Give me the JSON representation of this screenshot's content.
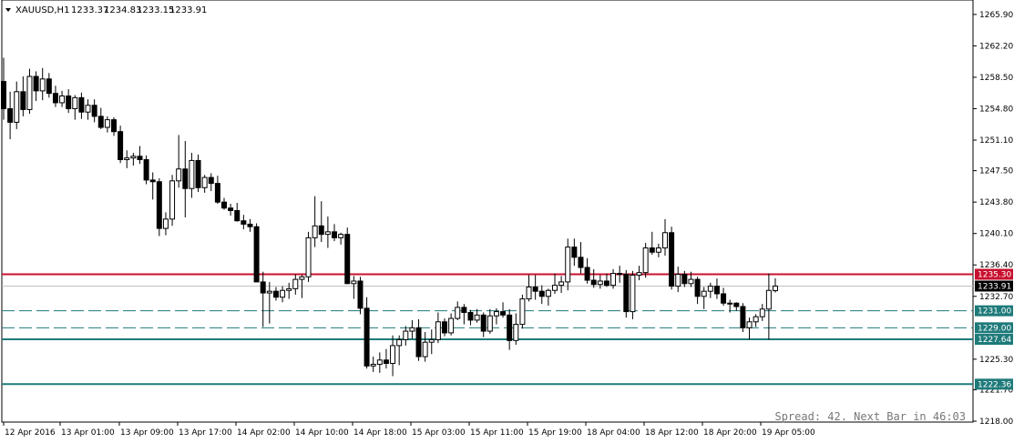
{
  "chart_data": {
    "type": "candlestick",
    "title": "XAUUSD,H1",
    "ohlc_header": [
      "1233.37",
      "1234.83",
      "1233.15",
      "1233.91"
    ],
    "ylim": [
      1218.0,
      1267.6
    ],
    "y_ticks": [
      "1265.90",
      "1262.20",
      "1258.50",
      "1254.80",
      "1251.10",
      "1247.50",
      "1243.80",
      "1240.10",
      "1236.40",
      "1232.70",
      "1225.30",
      "1221.70",
      "1218.00"
    ],
    "x_ticks": [
      "12 Apr 2016",
      "13 Apr 01:00",
      "13 Apr 09:00",
      "13 Apr 17:00",
      "14 Apr 02:00",
      "14 Apr 10:00",
      "14 Apr 18:00",
      "15 Apr 03:00",
      "15 Apr 11:00",
      "15 Apr 19:00",
      "18 Apr 04:00",
      "18 Apr 12:00",
      "18 Apr 20:00",
      "19 Apr 05:00"
    ],
    "levels": [
      {
        "label": "1235.30",
        "value": 1235.3,
        "style": "solid",
        "color": "#c8102e"
      },
      {
        "label": "1231.00",
        "value": 1231.0,
        "style": "dashed",
        "color": "#1f7a7a"
      },
      {
        "label": "1229.00",
        "value": 1229.0,
        "style": "dashed",
        "color": "#1f7a7a"
      },
      {
        "label": "1227.64",
        "value": 1227.64,
        "style": "solid",
        "color": "#1f7a7a"
      },
      {
        "label": "1222.36",
        "value": 1222.36,
        "style": "solid",
        "color": "#1f7a7a"
      }
    ],
    "current_price": {
      "label": "1233.91",
      "value": 1233.91
    },
    "spread_text": "Spread: 42. Next Bar in 46:03",
    "candles": [
      [
        1258.0,
        1260.8,
        1253.5,
        1254.8
      ],
      [
        1254.8,
        1256.8,
        1251.2,
        1253.2
      ],
      [
        1253.2,
        1258.0,
        1252.4,
        1256.8
      ],
      [
        1256.8,
        1258.6,
        1253.9,
        1254.7
      ],
      [
        1254.7,
        1259.5,
        1254.2,
        1258.6
      ],
      [
        1258.6,
        1259.2,
        1255.7,
        1256.9
      ],
      [
        1256.9,
        1259.6,
        1255.8,
        1258.3
      ],
      [
        1258.3,
        1259.0,
        1256.1,
        1256.6
      ],
      [
        1256.6,
        1257.5,
        1255.0,
        1255.5
      ],
      [
        1255.5,
        1256.9,
        1255.0,
        1256.3
      ],
      [
        1256.3,
        1257.1,
        1254.3,
        1254.8
      ],
      [
        1254.8,
        1256.4,
        1253.5,
        1256.1
      ],
      [
        1256.1,
        1256.7,
        1253.6,
        1254.4
      ],
      [
        1254.4,
        1255.9,
        1253.5,
        1255.2
      ],
      [
        1255.2,
        1255.9,
        1253.2,
        1253.9
      ],
      [
        1253.9,
        1254.9,
        1252.4,
        1252.6
      ],
      [
        1252.6,
        1253.9,
        1252.0,
        1253.5
      ],
      [
        1253.5,
        1253.8,
        1251.6,
        1252.1
      ],
      [
        1252.1,
        1252.8,
        1248.4,
        1248.8
      ],
      [
        1248.8,
        1249.9,
        1247.8,
        1249.0
      ],
      [
        1249.0,
        1249.6,
        1248.1,
        1249.2
      ],
      [
        1249.2,
        1250.4,
        1248.3,
        1248.8
      ],
      [
        1248.8,
        1249.3,
        1245.9,
        1246.4
      ],
      [
        1246.4,
        1247.3,
        1244.1,
        1246.2
      ],
      [
        1246.2,
        1246.6,
        1239.8,
        1240.7
      ],
      [
        1240.7,
        1242.6,
        1239.9,
        1241.8
      ],
      [
        1241.8,
        1247.0,
        1241.0,
        1246.3
      ],
      [
        1246.3,
        1251.7,
        1245.5,
        1247.7
      ],
      [
        1247.7,
        1251.0,
        1242.0,
        1245.4
      ],
      [
        1245.4,
        1249.6,
        1244.3,
        1248.7
      ],
      [
        1248.7,
        1249.4,
        1245.0,
        1245.5
      ],
      [
        1245.5,
        1247.0,
        1244.9,
        1246.7
      ],
      [
        1246.7,
        1247.2,
        1245.1,
        1246.0
      ],
      [
        1246.0,
        1246.9,
        1243.6,
        1243.8
      ],
      [
        1243.8,
        1244.3,
        1242.9,
        1243.1
      ],
      [
        1243.1,
        1243.6,
        1242.2,
        1242.8
      ],
      [
        1242.8,
        1243.7,
        1241.5,
        1241.6
      ],
      [
        1241.6,
        1242.3,
        1240.6,
        1241.2
      ],
      [
        1241.2,
        1241.8,
        1240.3,
        1240.9
      ],
      [
        1240.9,
        1241.3,
        1235.9,
        1234.4
      ],
      [
        1234.4,
        1235.6,
        1229.1,
        1233.1
      ],
      [
        1233.1,
        1234.4,
        1229.5,
        1233.3
      ],
      [
        1233.3,
        1233.8,
        1232.2,
        1232.6
      ],
      [
        1232.6,
        1233.9,
        1232.0,
        1233.4
      ],
      [
        1233.4,
        1234.3,
        1232.4,
        1233.6
      ],
      [
        1233.6,
        1235.3,
        1232.9,
        1234.7
      ],
      [
        1234.7,
        1235.2,
        1232.5,
        1235.0
      ],
      [
        1235.0,
        1240.3,
        1234.4,
        1239.6
      ],
      [
        1239.6,
        1244.5,
        1238.5,
        1241.0
      ],
      [
        1241.0,
        1243.9,
        1239.1,
        1240.0
      ],
      [
        1240.0,
        1242.1,
        1238.4,
        1240.3
      ],
      [
        1240.3,
        1241.2,
        1239.2,
        1239.6
      ],
      [
        1239.6,
        1240.2,
        1238.8,
        1240.0
      ],
      [
        1240.0,
        1240.8,
        1234.7,
        1234.2
      ],
      [
        1234.2,
        1235.1,
        1232.4,
        1234.5
      ],
      [
        1234.5,
        1235.0,
        1230.6,
        1231.3
      ],
      [
        1231.3,
        1232.6,
        1224.2,
        1224.5
      ],
      [
        1224.5,
        1225.6,
        1223.8,
        1224.7
      ],
      [
        1224.7,
        1226.1,
        1223.7,
        1225.2
      ],
      [
        1225.2,
        1226.5,
        1224.2,
        1224.8
      ],
      [
        1224.8,
        1228.1,
        1223.3,
        1226.9
      ],
      [
        1226.9,
        1228.1,
        1224.6,
        1227.6
      ],
      [
        1227.6,
        1229.2,
        1226.9,
        1228.6
      ],
      [
        1228.6,
        1229.9,
        1227.7,
        1229.0
      ],
      [
        1229.0,
        1230.0,
        1225.1,
        1225.6
      ],
      [
        1225.6,
        1228.5,
        1225.0,
        1227.3
      ],
      [
        1227.3,
        1228.8,
        1225.9,
        1227.6
      ],
      [
        1227.6,
        1230.8,
        1227.2,
        1229.7
      ],
      [
        1229.7,
        1230.1,
        1228.0,
        1228.4
      ],
      [
        1228.4,
        1230.7,
        1228.1,
        1230.1
      ],
      [
        1230.1,
        1232.1,
        1229.9,
        1231.4
      ],
      [
        1231.4,
        1231.8,
        1229.4,
        1230.8
      ],
      [
        1230.8,
        1231.1,
        1229.3,
        1229.9
      ],
      [
        1229.9,
        1231.2,
        1229.6,
        1230.5
      ],
      [
        1230.5,
        1230.8,
        1227.9,
        1228.6
      ],
      [
        1228.6,
        1231.2,
        1228.3,
        1230.4
      ],
      [
        1230.4,
        1231.3,
        1229.4,
        1230.9
      ],
      [
        1230.9,
        1232.0,
        1230.2,
        1230.5
      ],
      [
        1230.5,
        1231.2,
        1226.4,
        1227.5
      ],
      [
        1227.5,
        1230.7,
        1227.0,
        1229.4
      ],
      [
        1229.4,
        1232.9,
        1228.9,
        1232.4
      ],
      [
        1232.4,
        1235.2,
        1232.1,
        1233.8
      ],
      [
        1233.8,
        1235.2,
        1232.3,
        1233.3
      ],
      [
        1233.3,
        1234.0,
        1231.8,
        1232.7
      ],
      [
        1232.7,
        1233.6,
        1231.6,
        1233.4
      ],
      [
        1233.4,
        1235.4,
        1233.0,
        1234.0
      ],
      [
        1234.0,
        1235.1,
        1233.1,
        1234.4
      ],
      [
        1234.4,
        1239.5,
        1233.4,
        1238.5
      ],
      [
        1238.5,
        1239.5,
        1236.3,
        1237.3
      ],
      [
        1237.3,
        1239.1,
        1235.4,
        1236.1
      ],
      [
        1236.1,
        1237.2,
        1234.2,
        1234.6
      ],
      [
        1234.6,
        1235.9,
        1233.7,
        1234.1
      ],
      [
        1234.1,
        1235.2,
        1233.6,
        1234.5
      ],
      [
        1234.5,
        1235.4,
        1233.8,
        1234.0
      ],
      [
        1234.0,
        1235.9,
        1233.6,
        1235.4
      ],
      [
        1235.4,
        1236.3,
        1234.3,
        1235.3
      ],
      [
        1235.3,
        1235.8,
        1230.2,
        1230.9
      ],
      [
        1230.9,
        1235.7,
        1230.0,
        1235.2
      ],
      [
        1235.2,
        1236.3,
        1234.6,
        1235.5
      ],
      [
        1235.5,
        1239.0,
        1234.9,
        1238.4
      ],
      [
        1238.4,
        1240.3,
        1237.6,
        1237.9
      ],
      [
        1237.9,
        1238.9,
        1237.3,
        1238.4
      ],
      [
        1238.4,
        1241.8,
        1237.5,
        1240.2
      ],
      [
        1240.2,
        1240.9,
        1233.5,
        1233.9
      ],
      [
        1233.9,
        1236.2,
        1233.2,
        1235.3
      ],
      [
        1235.3,
        1235.7,
        1233.8,
        1234.2
      ],
      [
        1234.2,
        1235.6,
        1233.8,
        1234.7
      ],
      [
        1234.7,
        1235.0,
        1231.8,
        1232.7
      ],
      [
        1232.7,
        1233.8,
        1231.2,
        1233.3
      ],
      [
        1233.3,
        1234.3,
        1232.5,
        1233.9
      ],
      [
        1233.9,
        1234.8,
        1232.4,
        1233.0
      ],
      [
        1233.0,
        1233.7,
        1231.6,
        1231.9
      ],
      [
        1231.9,
        1232.3,
        1230.8,
        1231.9
      ],
      [
        1231.9,
        1232.0,
        1231.0,
        1231.5
      ],
      [
        1231.5,
        1231.9,
        1228.5,
        1229.0
      ],
      [
        1229.0,
        1230.2,
        1227.6,
        1229.7
      ],
      [
        1229.7,
        1230.6,
        1229.1,
        1230.3
      ],
      [
        1230.3,
        1231.8,
        1229.8,
        1231.2
      ],
      [
        1231.2,
        1235.4,
        1227.6,
        1233.4
      ],
      [
        1233.37,
        1234.83,
        1233.15,
        1233.91
      ]
    ]
  }
}
